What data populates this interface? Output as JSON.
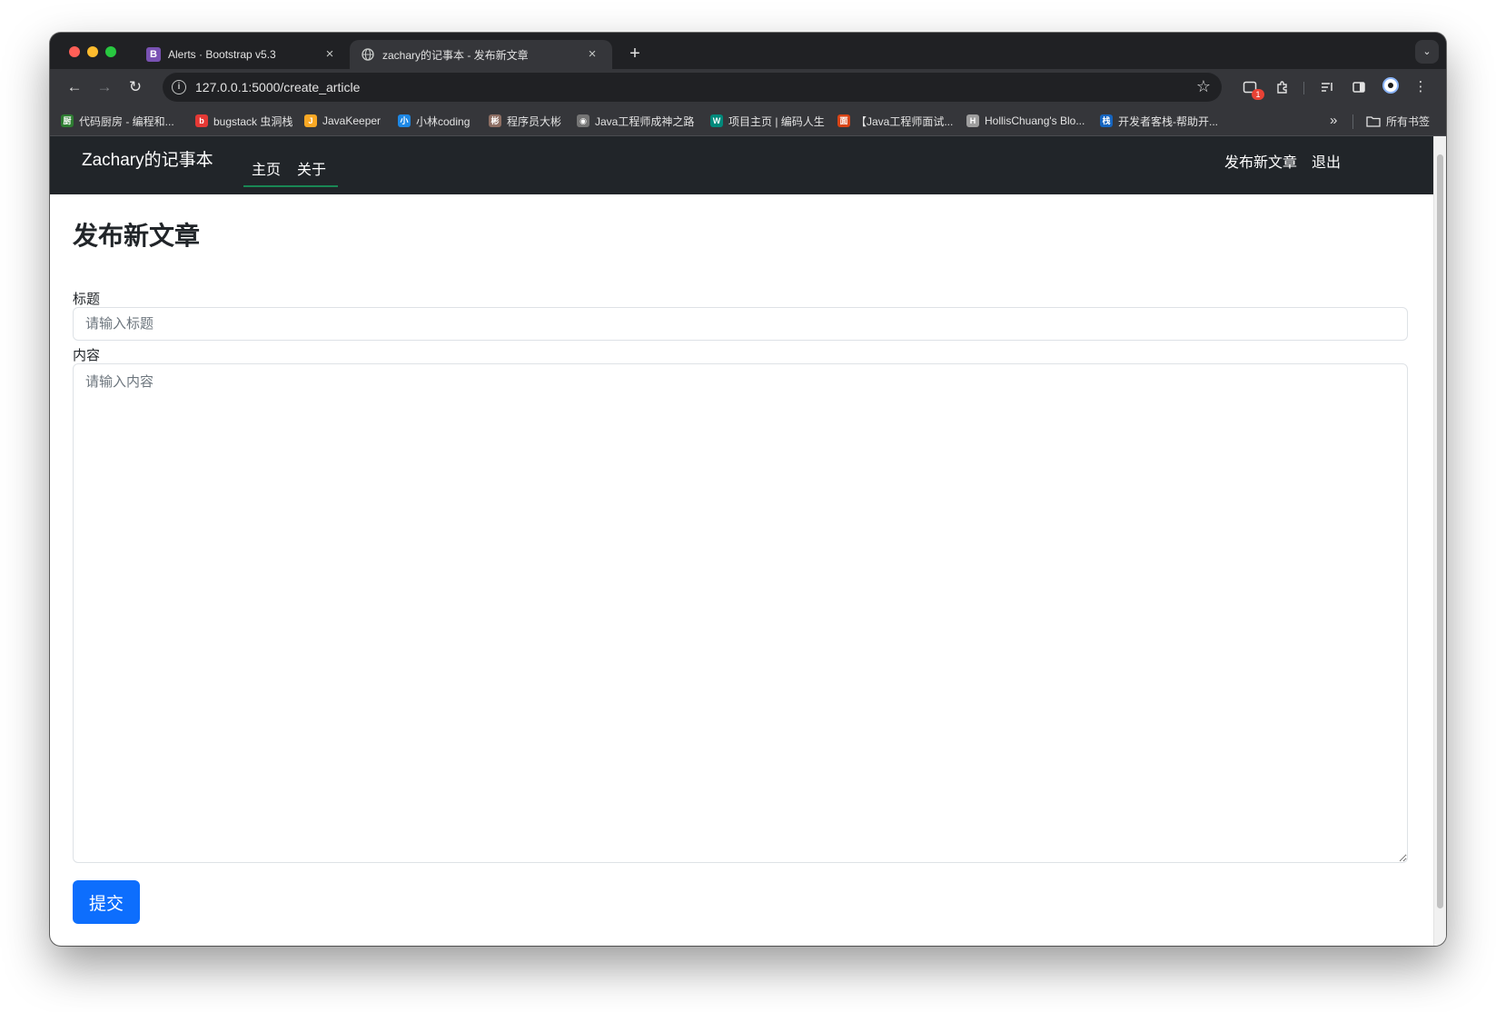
{
  "browser": {
    "tabs": [
      {
        "title": "Alerts · Bootstrap v5.3",
        "favicon": "B",
        "active": false
      },
      {
        "title": "zachary的记事本 - 发布新文章",
        "active": true
      }
    ],
    "new_tab": "+",
    "tab_search": "⌄",
    "url": "127.0.0.1:5000/create_article",
    "extension_badge": "1",
    "bookmarks": [
      {
        "label": "代码厨房 - 编程和...",
        "icon_color": "#2e7d32",
        "glyph": "厨"
      },
      {
        "label": "bugstack 虫洞栈",
        "icon_color": "#e53935",
        "glyph": "b"
      },
      {
        "label": "JavaKeeper",
        "icon_color": "#f9a825",
        "glyph": "J"
      },
      {
        "label": "小林coding",
        "icon_color": "#1e88e5",
        "glyph": "小"
      },
      {
        "label": "程序员大彬",
        "icon_color": "#8d6e63",
        "glyph": "彬"
      },
      {
        "label": "Java工程师成神之路",
        "icon_color": "#757575",
        "glyph": "◉"
      },
      {
        "label": "项目主页 | 编码人生",
        "icon_color": "#00897b",
        "glyph": "W"
      },
      {
        "label": "【Java工程师面试...",
        "icon_color": "#d84315",
        "glyph": "面"
      },
      {
        "label": "HollisChuang's Blo...",
        "icon_color": "#9e9e9e",
        "glyph": "H"
      },
      {
        "label": "开发者客栈-帮助开...",
        "icon_color": "#1565c0",
        "glyph": "栈"
      }
    ],
    "bookmarks_more": "»",
    "all_bookmarks": "所有书签"
  },
  "site": {
    "brand": "Zachary的记事本",
    "nav": [
      "主页",
      "关于"
    ],
    "right_nav": [
      "发布新文章",
      "退出"
    ]
  },
  "form": {
    "heading": "发布新文章",
    "title_label": "标题",
    "title_placeholder": "请输入标题",
    "title_value": "",
    "content_label": "内容",
    "content_placeholder": "请输入内容",
    "content_value": "",
    "submit_label": "提交"
  },
  "colors": {
    "navbar_bg": "#212529",
    "nav_active_underline": "#198754",
    "primary": "#0d6efd"
  }
}
